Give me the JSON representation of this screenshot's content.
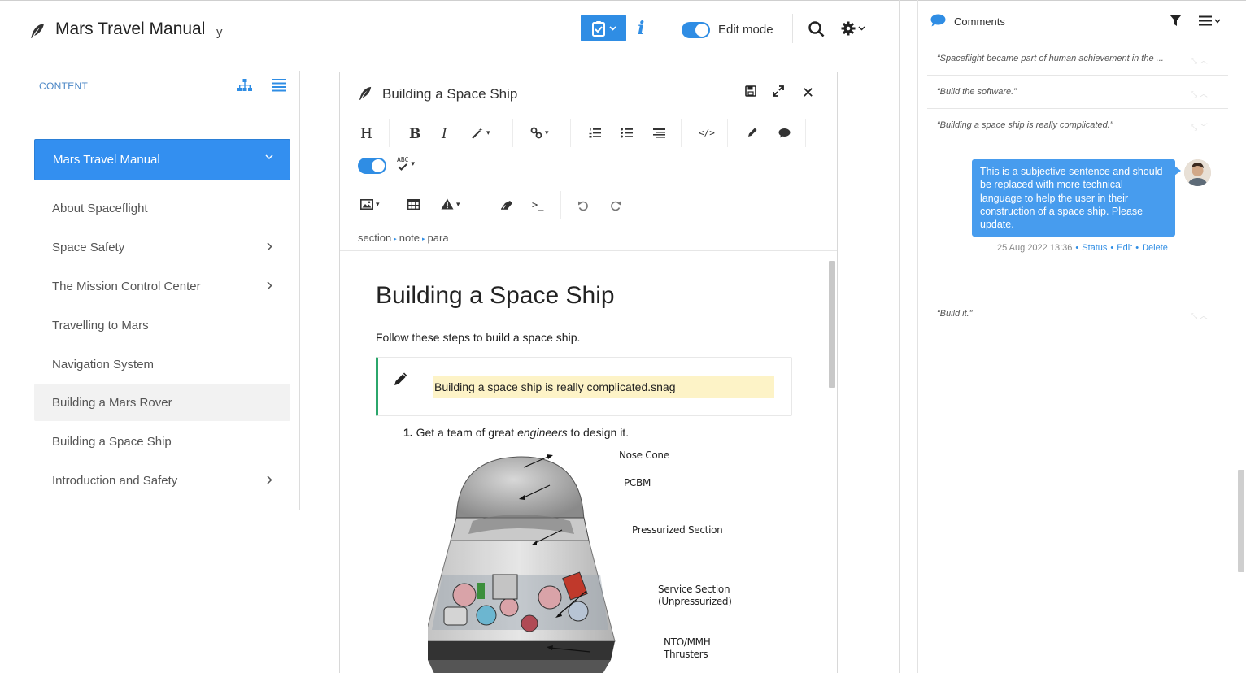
{
  "header": {
    "app_title": "Mars Travel Manual",
    "branch_symbol": "ȳ",
    "info_label": "i",
    "edit_mode_label": "Edit mode",
    "edit_mode_on": true
  },
  "sidebar": {
    "section_label": "CONTENT",
    "active_item": "Mars Travel Manual",
    "items": [
      {
        "label": "About Spaceflight",
        "has_children": false
      },
      {
        "label": "Space Safety",
        "has_children": true
      },
      {
        "label": "The Mission Control Center",
        "has_children": true
      },
      {
        "label": "Travelling to Mars",
        "has_children": false
      },
      {
        "label": "Navigation System",
        "has_children": false
      },
      {
        "label": "Building a Mars Rover",
        "has_children": false
      },
      {
        "label": "Building a Space Ship",
        "has_children": false
      },
      {
        "label": "Introduction and Safety",
        "has_children": true
      }
    ]
  },
  "editor": {
    "title": "Building a Space Ship",
    "toolbar": {
      "heading": "H",
      "bold": "B",
      "italic": "I",
      "spellcheck": "ABC",
      "code": "</>",
      "terminal": ">_"
    },
    "breadcrumb": [
      "section",
      "note",
      "para"
    ],
    "doc": {
      "heading": "Building a Space Ship",
      "intro": "Follow these steps to build a space ship.",
      "note": "Building a space ship is really complicated.snag",
      "step_number": "1.",
      "step_before": "Get a team of great",
      "step_em": "engineers",
      "step_after": "to design it.",
      "figure_labels": {
        "nose_cone": "Nose Cone",
        "pcbm": "PCBM",
        "pressurized": "Pressurized Section",
        "service1": "Service Section",
        "service2": "(Unpressurized)",
        "nto1": "NTO/MMH",
        "nto2": "Thrusters"
      }
    }
  },
  "comments": {
    "title": "Comments",
    "threads": [
      {
        "quote": "“Spaceflight became part of human achievement in the ..."
      },
      {
        "quote": "“Build the software.”"
      },
      {
        "quote": "“Building a space ship is really complicated.”"
      },
      {
        "quote": "“Build it.”"
      }
    ],
    "message": "This is a subjective sentence and should be replaced with more technical language to help the user in their construction of a space ship. Please update.",
    "timestamp": "25 Aug 2022 13:36",
    "actions": [
      "Status",
      "Edit",
      "Delete"
    ]
  },
  "colors": {
    "accent": "#2f8de4",
    "active_item": "#338ff0",
    "note_border": "#2ba66b",
    "highlight": "#fdf3c7"
  }
}
